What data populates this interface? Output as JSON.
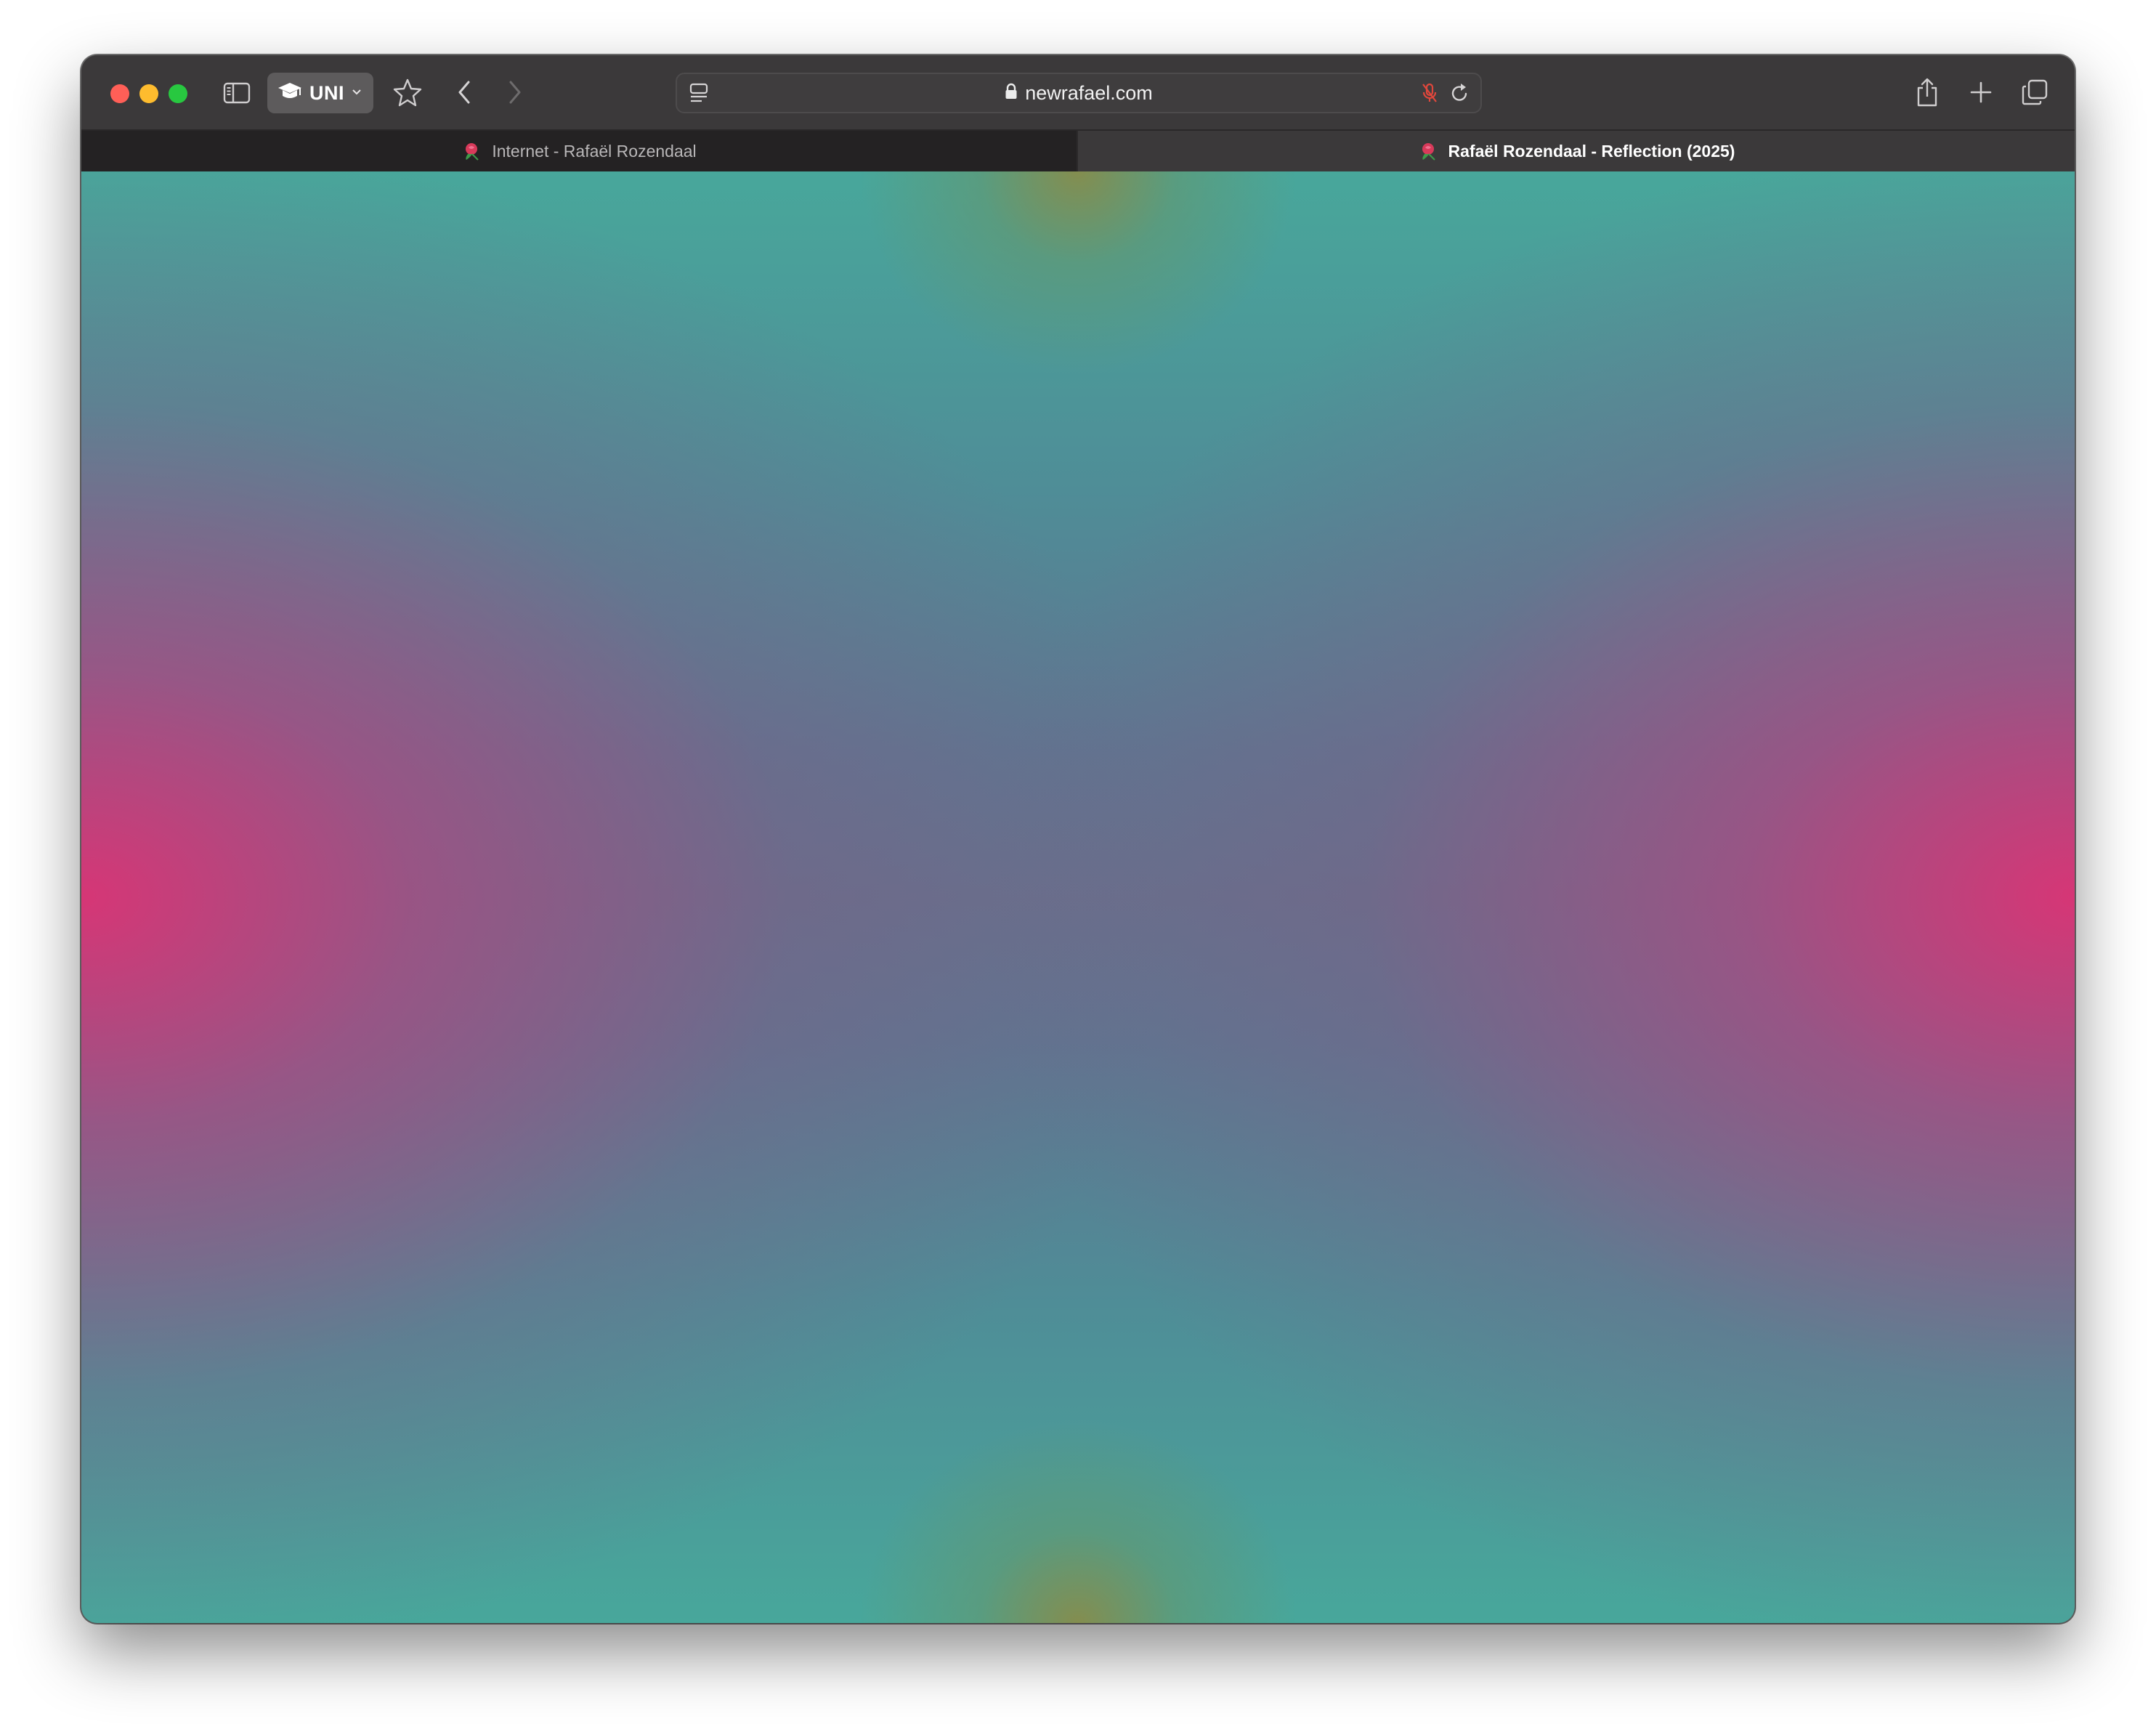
{
  "browser": {
    "profile_label": "UNI",
    "url": "newrafael.com"
  },
  "tabs": [
    {
      "title": "Internet - Rafaël Rozendaal",
      "active": false
    },
    {
      "title": "Rafaël Rozendaal - Reflection (2025)",
      "active": true
    }
  ],
  "colors": {
    "gradient_pink": "#d63676",
    "gradient_teal": "#48a79b",
    "gradient_slate": "#66708c",
    "gradient_olive": "#878c4b",
    "mic_red": "#e0473c"
  },
  "icons": {
    "sidebar": "sidebar-icon",
    "profile": "graduation-cap-icon",
    "bookmark": "star-icon",
    "back": "chevron-left-icon",
    "forward": "chevron-right-icon",
    "reader": "reader-icon",
    "lock": "lock-icon",
    "mic": "mic-muted-icon",
    "reload": "reload-icon",
    "share": "share-icon",
    "new_tab": "plus-icon",
    "tab_overview": "tab-overview-icon",
    "favicon": "rose-icon"
  }
}
